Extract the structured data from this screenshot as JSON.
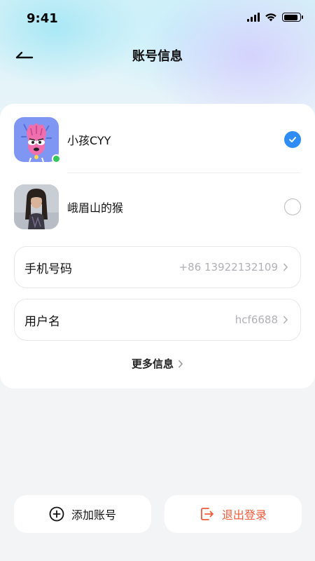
{
  "status_bar": {
    "time": "9:41",
    "battery_level": 0.9
  },
  "header": {
    "title": "账号信息",
    "back_icon": "back-arrow-icon"
  },
  "accounts": [
    {
      "name": "小孩CYY",
      "selected": true,
      "online": true,
      "avatar": "cartoon-avatar"
    },
    {
      "name": "峨眉山的猴",
      "selected": false,
      "online": false,
      "avatar": "photo-avatar"
    }
  ],
  "fields": {
    "phone": {
      "label": "手机号码",
      "value": "+86 13922132109"
    },
    "username": {
      "label": "用户名",
      "value": "hcf6688"
    }
  },
  "more_info": {
    "label": "更多信息"
  },
  "actions": {
    "add_account": {
      "label": "添加账号",
      "icon": "plus-circle-icon"
    },
    "logout": {
      "label": "退出登录",
      "icon": "logout-icon"
    }
  },
  "colors": {
    "accent": "#2f8cf6",
    "danger": "#f05a3a",
    "online": "#34c759"
  }
}
